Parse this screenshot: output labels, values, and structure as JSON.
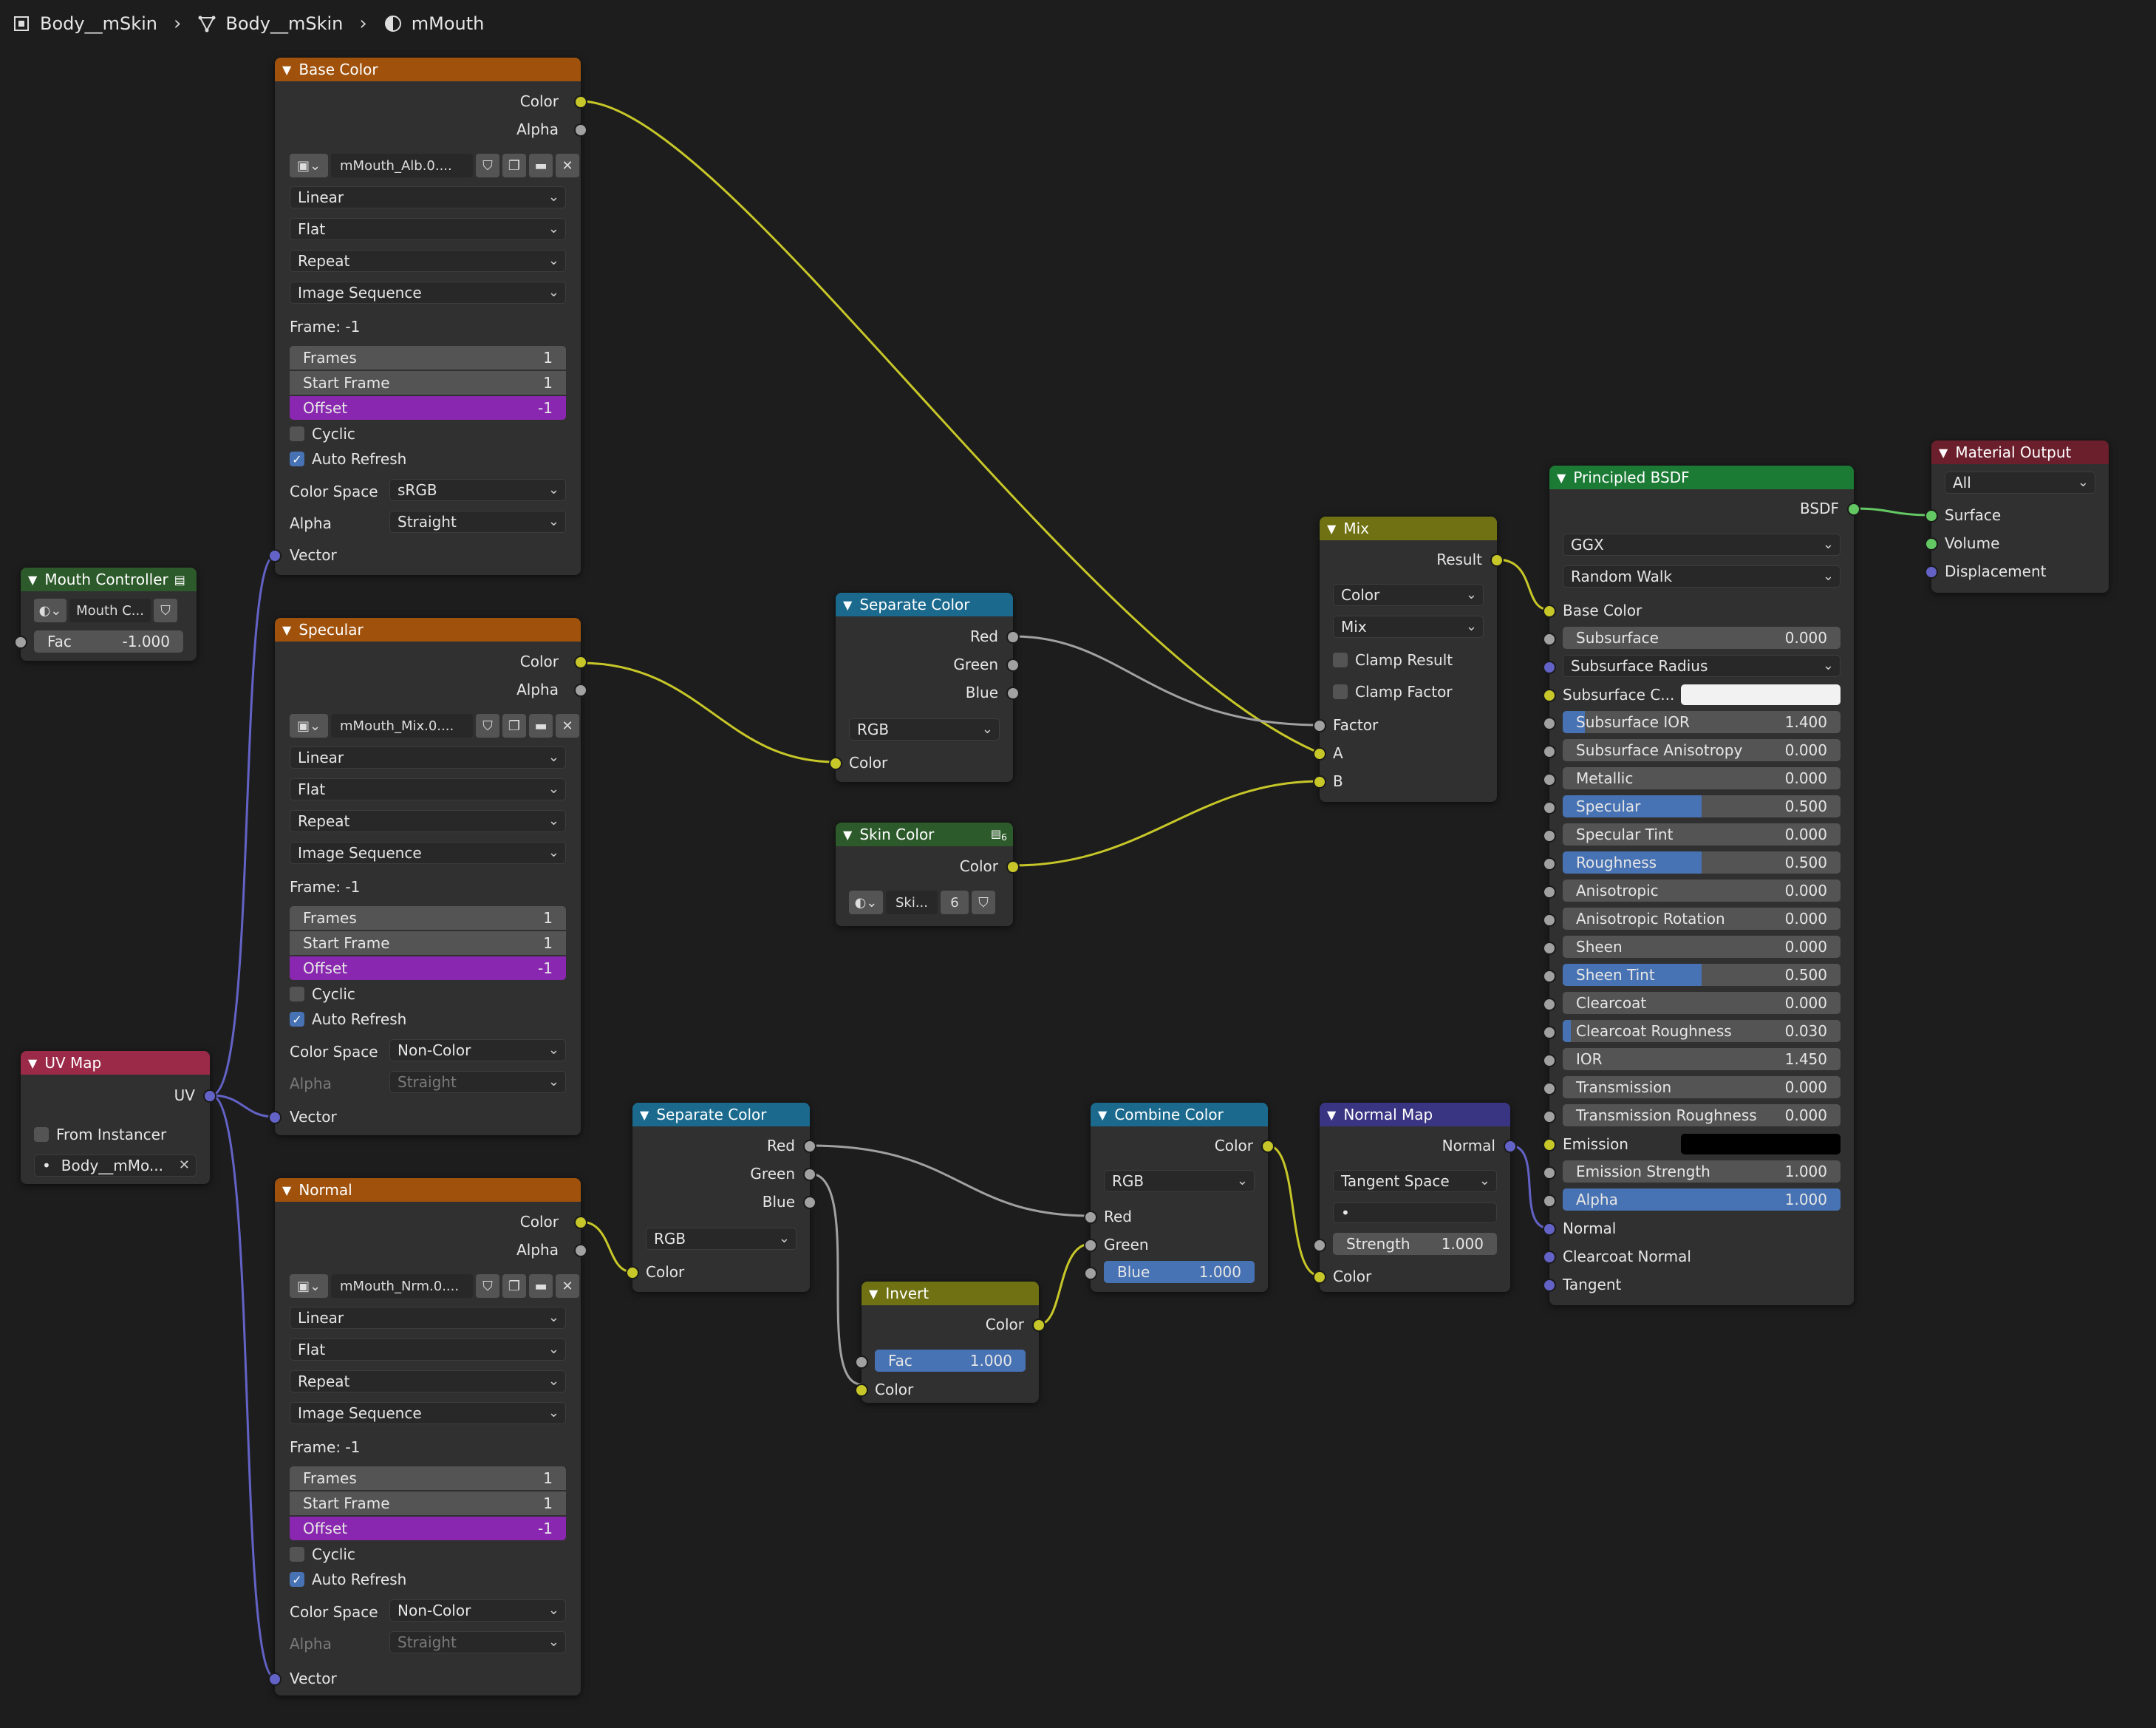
{
  "breadcrumb": {
    "item1": "Body__mSkin",
    "item2": "Body__mSkin",
    "item3": "mMouth"
  },
  "colors": {
    "image_header": "#a0520c",
    "group_header": "#2d5a2a",
    "converter_header": "#1b6a8e",
    "color_header": "#6f7112",
    "vector_header": "#3a3582",
    "shader_header": "#1b7b35",
    "output_header": "#6b1f2c",
    "input_header": "#9b2a48",
    "socket_color": "#c7c729",
    "socket_float": "#a1a1a1",
    "socket_vector": "#6363c7",
    "socket_shader": "#63c763",
    "slider_fill": "#4772b3",
    "offset_field": "#8a27b0"
  },
  "common": {
    "color": "Color",
    "alpha": "Alpha",
    "vector": "Vector",
    "linear": "Linear",
    "flat": "Flat",
    "repeat": "Repeat",
    "image_sequence": "Image Sequence",
    "frame_label": "Frame: -1",
    "frames": "Frames",
    "frames_val": "1",
    "start_frame": "Start Frame",
    "start_frame_val": "1",
    "offset": "Offset",
    "offset_val": "-1",
    "cyclic": "Cyclic",
    "auto_refresh": "Auto Refresh",
    "color_space": "Color Space",
    "straight": "Straight",
    "red": "Red",
    "green": "Green",
    "blue": "Blue",
    "rgb": "RGB"
  },
  "base_color": {
    "title": "Base Color",
    "image": "mMouth_Alb.0....",
    "color_space": "sRGB"
  },
  "specular": {
    "title": "Specular",
    "image": "mMouth_Mix.0....",
    "color_space": "Non-Color"
  },
  "normal_tex": {
    "title": "Normal",
    "image": "mMouth_Nrm.0....",
    "color_space": "Non-Color"
  },
  "mouth_controller": {
    "title": "Mouth Controller",
    "datablock": "Mouth C...",
    "fac_label": "Fac",
    "fac_value": "-1.000"
  },
  "uv_map": {
    "title": "UV Map",
    "uv": "UV",
    "from_instancer": "From Instancer",
    "map_name": "Body__mMo..."
  },
  "sep_color_1": {
    "title": "Separate Color"
  },
  "skin_color": {
    "title": "Skin Color",
    "users": "6",
    "datablock": "Ski...",
    "count": "6",
    "color": "Color"
  },
  "sep_color_2": {
    "title": "Separate Color"
  },
  "invert": {
    "title": "Invert",
    "color": "Color",
    "fac_label": "Fac",
    "fac_value": "1.000",
    "fac_fraction": 1.0
  },
  "combine_color": {
    "title": "Combine Color",
    "color": "Color",
    "mode": "RGB",
    "red": "Red",
    "green": "Green",
    "blue_label": "Blue",
    "blue_value": "1.000",
    "blue_fraction": 1.0
  },
  "normal_map": {
    "title": "Normal Map",
    "normal": "Normal",
    "space": "Tangent Space",
    "uv_field": "•",
    "strength_label": "Strength",
    "strength_value": "1.000",
    "color": "Color"
  },
  "mix": {
    "title": "Mix",
    "result": "Result",
    "data_type": "Color",
    "blend": "Mix",
    "clamp_result": "Clamp Result",
    "clamp_factor": "Clamp Factor",
    "factor": "Factor",
    "a": "A",
    "b": "B"
  },
  "bsdf": {
    "title": "Principled BSDF",
    "output": "BSDF",
    "distribution": "GGX",
    "subsurface_method": "Random Walk",
    "base_color": "Base Color",
    "subsurface_label": "Subsurface",
    "subsurface_value": "0.000",
    "subsurface_radius": "Subsurface Radius",
    "subsurface_color": "Subsurface C...",
    "fields": [
      {
        "label": "Subsurface IOR",
        "value": "1.400",
        "fill": 0.08
      },
      {
        "label": "Subsurface Anisotropy",
        "value": "0.000",
        "fill": 0
      },
      {
        "label": "Metallic",
        "value": "0.000",
        "fill": 0
      },
      {
        "label": "Specular",
        "value": "0.500",
        "fill": 0.5
      },
      {
        "label": "Specular Tint",
        "value": "0.000",
        "fill": 0
      },
      {
        "label": "Roughness",
        "value": "0.500",
        "fill": 0.5
      },
      {
        "label": "Anisotropic",
        "value": "0.000",
        "fill": 0
      },
      {
        "label": "Anisotropic Rotation",
        "value": "0.000",
        "fill": 0
      },
      {
        "label": "Sheen",
        "value": "0.000",
        "fill": 0
      },
      {
        "label": "Sheen Tint",
        "value": "0.500",
        "fill": 0.5
      },
      {
        "label": "Clearcoat",
        "value": "0.000",
        "fill": 0
      },
      {
        "label": "Clearcoat Roughness",
        "value": "0.030",
        "fill": 0.03
      },
      {
        "label": "IOR",
        "value": "1.450",
        "fill": 0
      },
      {
        "label": "Transmission",
        "value": "0.000",
        "fill": 0
      },
      {
        "label": "Transmission Roughness",
        "value": "0.000",
        "fill": 0
      }
    ],
    "emission": "Emission",
    "emission_strength_label": "Emission Strength",
    "emission_strength_value": "1.000",
    "alpha_label": "Alpha",
    "alpha_value": "1.000",
    "alpha_fraction": 1.0,
    "normal": "Normal",
    "clearcoat_normal": "Clearcoat Normal",
    "tangent": "Tangent"
  },
  "material_output": {
    "title": "Material Output",
    "target": "All",
    "surface": "Surface",
    "volume": "Volume",
    "displacement": "Displacement"
  }
}
